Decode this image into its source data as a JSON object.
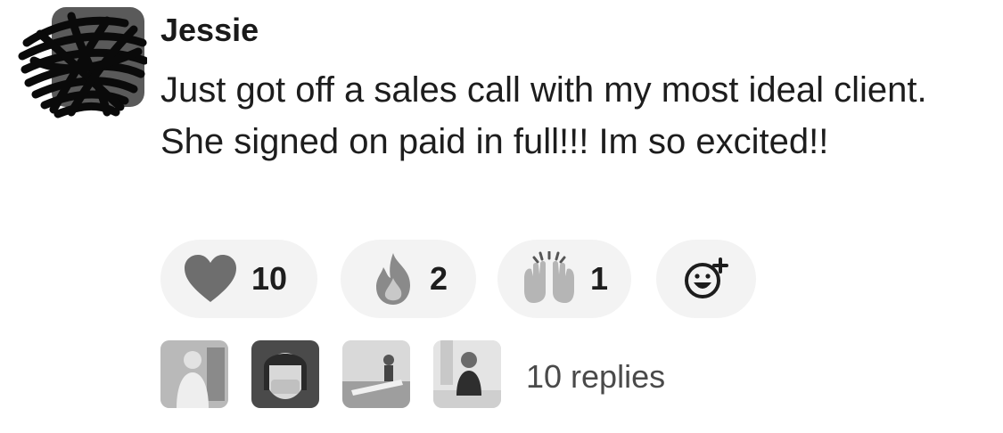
{
  "message": {
    "author": "Jessie",
    "text": "Just got off a sales call with my most ideal client. She signed on paid in full!!! Im so excited!!"
  },
  "reactions": [
    {
      "emoji_icon": "heart-icon",
      "count": "10"
    },
    {
      "emoji_icon": "fire-icon",
      "count": "2"
    },
    {
      "emoji_icon": "raising-hands-icon",
      "count": "1"
    }
  ],
  "add_reaction_icon": "add-reaction-icon",
  "thread": {
    "replies_label": "10 replies"
  },
  "colors": {
    "pill_bg": "#f3f3f3",
    "text": "#1d1d1d",
    "muted_text": "#4a4a4a"
  }
}
